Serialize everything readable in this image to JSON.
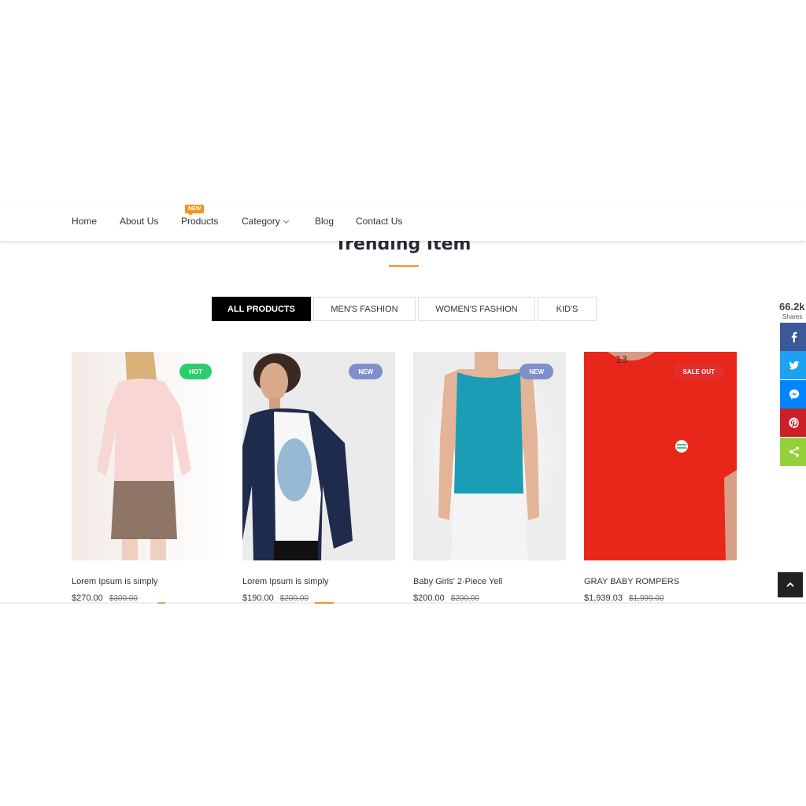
{
  "nav": {
    "items": [
      {
        "label": "Home"
      },
      {
        "label": "About Us"
      },
      {
        "label": "Products",
        "badge": "NEW"
      },
      {
        "label": "Category"
      },
      {
        "label": "Blog"
      },
      {
        "label": "Contact Us"
      }
    ]
  },
  "section": {
    "title": "Trending Item"
  },
  "tabs": [
    {
      "label": "All Products",
      "active": true
    },
    {
      "label": "Men's Fashion"
    },
    {
      "label": "Women's Fashion"
    },
    {
      "label": "Kid's"
    }
  ],
  "products": [
    {
      "name": "Lorem Ipsum is simply",
      "price": "$270.00",
      "old_price": "$300.00",
      "badge": "HOT",
      "badge_color": "#2ecc71"
    },
    {
      "name": "Lorem Ipsum is simply",
      "price": "$190.00",
      "old_price": "$200.00",
      "badge": "NEW",
      "badge_color": "#7f8fc9"
    },
    {
      "name": "Baby Girls' 2-Piece Yell",
      "price": "$200.00",
      "old_price": "$200.00",
      "badge": "NEW",
      "badge_color": "#7f8fc9"
    },
    {
      "name": "GRAY BABY ROMPERS",
      "price": "$1,939.03",
      "old_price": "$1,999.00",
      "badge": "SALE OUT",
      "badge_color": "#e12f2f"
    }
  ],
  "share": {
    "count": "66.2k",
    "label": "Shares",
    "buttons": [
      {
        "icon": "facebook-icon",
        "color": "#3b5998"
      },
      {
        "icon": "twitter-icon",
        "color": "#1da1f2"
      },
      {
        "icon": "messenger-icon",
        "color": "#0084ff"
      },
      {
        "icon": "pinterest-icon",
        "color": "#cb2027"
      },
      {
        "icon": "share-icon",
        "color": "#95d03a"
      }
    ]
  },
  "colors": {
    "accent": "#f7941d",
    "dark": "#000000"
  }
}
